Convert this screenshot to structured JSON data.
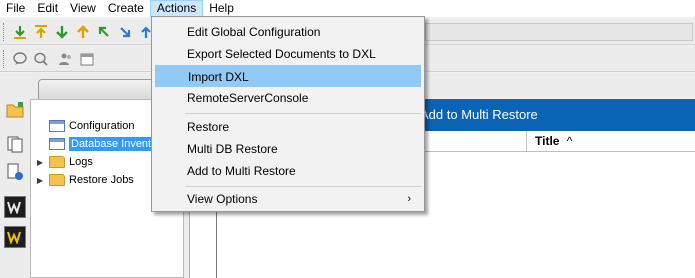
{
  "menubar": {
    "items": [
      "File",
      "Edit",
      "View",
      "Create",
      "Actions",
      "Help"
    ],
    "active": "Actions"
  },
  "actions_menu": {
    "items": [
      {
        "label": "Edit Global Configuration"
      },
      {
        "label": "Export Selected Documents to DXL"
      },
      {
        "label": "Import DXL",
        "highlighted": true
      },
      {
        "label": "RemoteServerConsole"
      },
      {
        "label": "Restore"
      },
      {
        "label": "Multi DB Restore"
      },
      {
        "label": "Add to Multi Restore"
      },
      {
        "label": "View Options",
        "submenu": true
      }
    ],
    "submenu_arrow": "›"
  },
  "navigator": {
    "items": [
      {
        "label": "Configuration",
        "icon": "document-icon",
        "expandable": false
      },
      {
        "label": "Database Invent",
        "icon": "document-icon",
        "expandable": false,
        "selected": true
      },
      {
        "label": "Logs",
        "icon": "folder-icon",
        "expandable": true
      },
      {
        "label": "Restore Jobs",
        "icon": "folder-icon",
        "expandable": true
      }
    ],
    "expand_glyph": "▶"
  },
  "action_bar": {
    "label": "Add to Multi Restore"
  },
  "grid": {
    "columns": [
      {
        "label": "Title",
        "sort": "ascending"
      }
    ],
    "sort_glyph": "^"
  },
  "colors": {
    "action_bar_bg": "#0b63b5",
    "menu_highlight": "#91c9f7",
    "selection": "#3399ff",
    "folder": "#f5c24b"
  }
}
